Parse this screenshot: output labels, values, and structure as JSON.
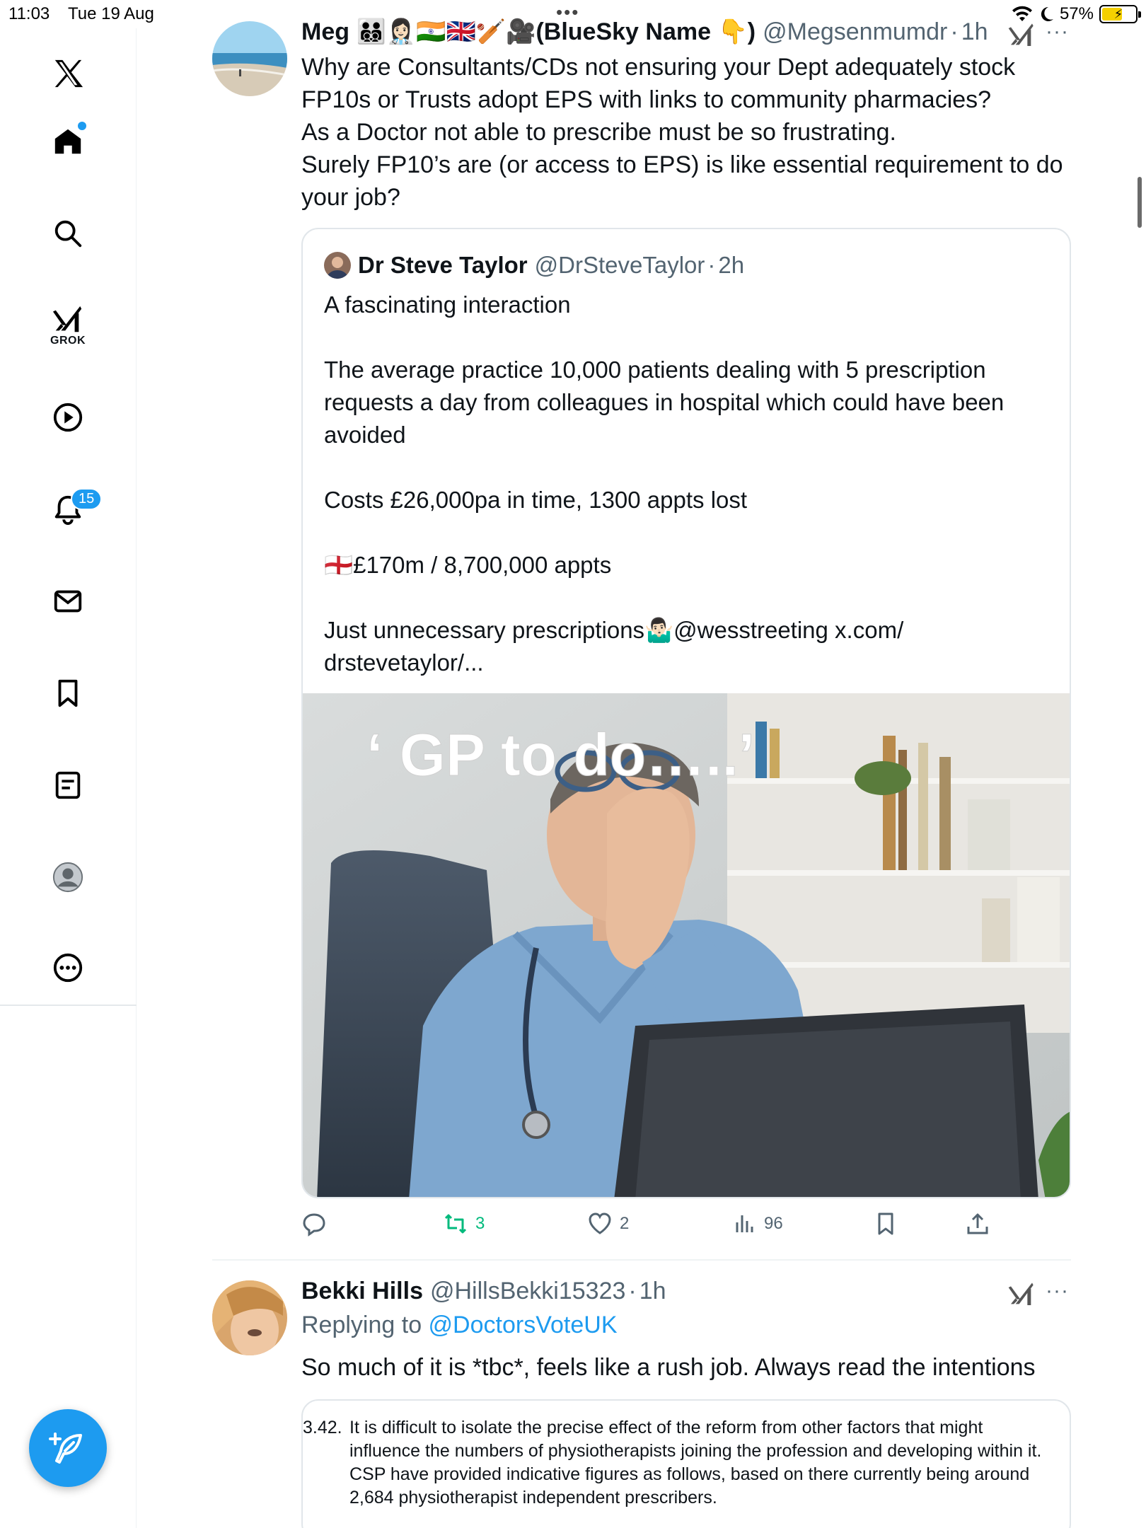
{
  "status_bar": {
    "time": "11:03",
    "date": "Tue 19 Aug",
    "battery": "57%",
    "top_dots": "•••"
  },
  "sidebar": {
    "grok_label": "GROK",
    "notifications_badge": "15",
    "items": [
      "x-logo",
      "home",
      "explore",
      "grok",
      "videos",
      "notifications",
      "messages",
      "bookmarks",
      "lists",
      "profile",
      "more"
    ]
  },
  "tweet1": {
    "name": "Meg 🧑‍🧑‍🧒‍🧒👩🏻‍⚕️🇮🇳🇬🇧🏏🎥(BlueSky Name 👇)",
    "handle": "@Megsenmumdr",
    "sep": "·",
    "time": "1h",
    "more": "···",
    "text_lines": [
      "Why are Consultants/CDs not ensuring your Dept adequately stock",
      "FP10s or Trusts adopt EPS with links to community pharmacies?",
      "As a Doctor not able to prescribe must be so frustrating.",
      "Surely  FP10’s are (or access to EPS) is like essential requirement to do",
      "your job?"
    ],
    "quote": {
      "name": "Dr Steve Taylor",
      "handle": "@DrSteveTaylor",
      "sep": "·",
      "time": "2h",
      "line1": "A fascinating interaction",
      "line2": "The average practice 10,000 patients dealing with 5 prescription",
      "line3": "requests a day from colleagues in hospital which could have been",
      "line4": "avoided",
      "line5": "Costs £26,000pa in time, 1300 appts lost",
      "line6": "🏴󠁧󠁢󠁥󠁮󠁧󠁿£170m / 8,700,000 appts",
      "line7": "Just unnecessary prescriptions🤷🏻‍♂️@wesstreeting x.com/",
      "line8": "drstevetaylor/...",
      "image_caption": "‘ GP to do…..’"
    },
    "actions": {
      "replies": "",
      "reposts": "3",
      "likes": "2",
      "views": "96"
    }
  },
  "tweet2": {
    "name": "Bekki Hills",
    "handle": "@HillsBekki15323",
    "sep": "·",
    "time": "1h",
    "more": "···",
    "replying_prefix": "Replying to ",
    "replying_to": "@DoctorsVoteUK",
    "text": "So much of it is *tbc*, feels like a rush job. Always read the intentions",
    "doc": {
      "number": "3.42.",
      "line1": "It is difficult to isolate the precise effect of the reform from other factors that might",
      "line2": "influence the numbers of physiotherapists joining the profession and developing within it.",
      "line3": "CSP have provided indicative figures as follows, based on there currently being around",
      "line4": "2,684 physiotherapist independent prescribers."
    }
  },
  "colors": {
    "accent": "#1d9bf0",
    "repost": "#00ba7c",
    "muted": "#536471"
  }
}
